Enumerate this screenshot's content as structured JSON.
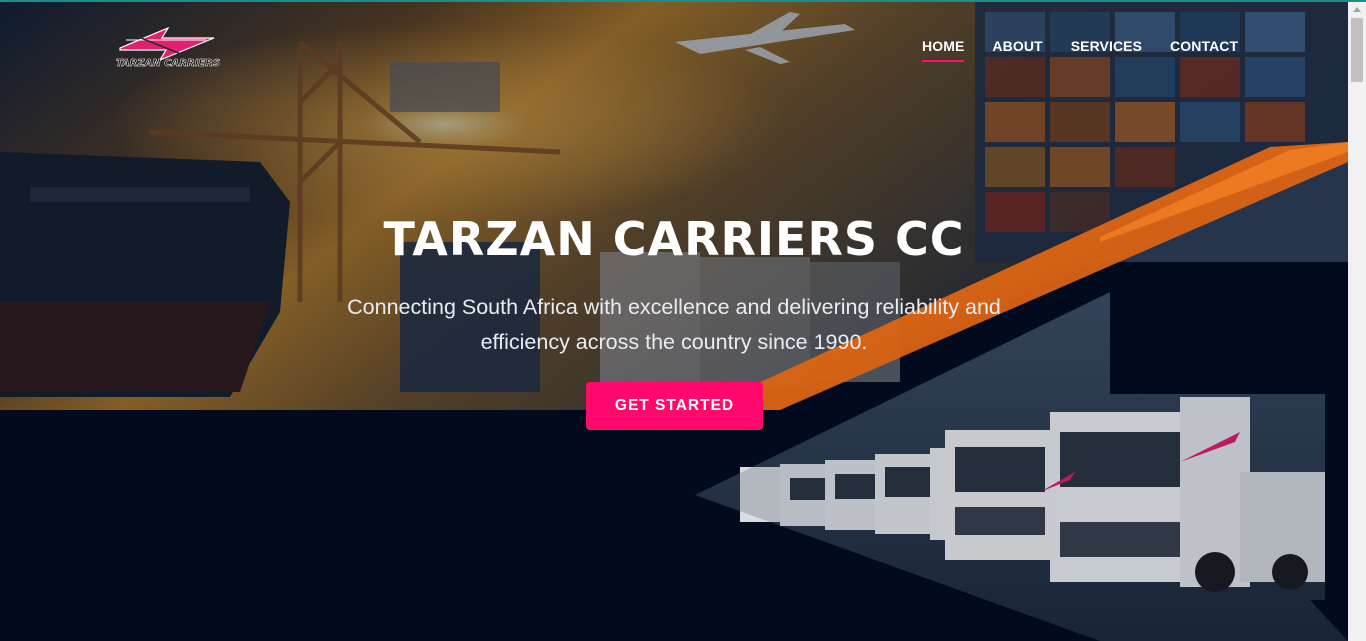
{
  "brand": {
    "logo_text": "TARZAN CARRIERS",
    "accent_color": "#ff0a6c"
  },
  "nav": {
    "items": [
      {
        "label": "HOME",
        "active": true
      },
      {
        "label": "ABOUT",
        "active": false
      },
      {
        "label": "SERVICES",
        "active": false
      },
      {
        "label": "CONTACT",
        "active": false
      }
    ]
  },
  "hero": {
    "title": "TARZAN CARRIERS CC",
    "subtitle": "Connecting South Africa with excellence and delivering reliability and efficiency across the country since 1990.",
    "cta_label": "GET STARTED",
    "background_image": "hero-logistics-photo",
    "secondary_image": "truck-fleet-photo"
  },
  "colors": {
    "background": "#030b1c",
    "text": "#ffffff",
    "accent": "#ff0a6c",
    "orange_band": "#e06a14"
  }
}
